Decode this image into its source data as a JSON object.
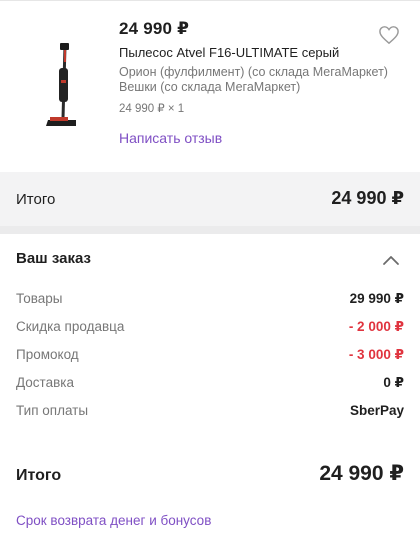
{
  "product": {
    "price": "24 990 ₽",
    "title": "Пылесос Atvel F16-ULTIMATE серый",
    "seller_line1": "Орион (фулфилмент) (со склада МегаМаркет)",
    "seller_line2": "Вешки (со склада МегаМаркет)",
    "quantity": "24 990 ₽ × 1",
    "review_link": "Написать отзыв",
    "favorite_icon": "heart-outline-icon",
    "image_icon": "vacuum-cleaner-image"
  },
  "summary": {
    "label": "Итого",
    "value": "24 990 ₽"
  },
  "order": {
    "title": "Ваш заказ",
    "toggle_icon": "chevron-up-icon",
    "rows": [
      {
        "label": "Товары",
        "value": "29 990 ₽"
      },
      {
        "label": "Скидка продавца",
        "value": "- 2 000 ₽"
      },
      {
        "label": "Промокод",
        "value": "- 3 000 ₽"
      },
      {
        "label": "Доставка",
        "value": "0 ₽"
      },
      {
        "label": "Тип оплаты",
        "value": "SberPay"
      }
    ],
    "total_label": "Итого",
    "total_value": "24 990 ₽",
    "refund_link": "Срок возврата денег и бонусов"
  },
  "colors": {
    "accent": "#7f4fc4",
    "negative": "#e0343f",
    "muted": "#777777",
    "band": "#f3f3f4"
  }
}
